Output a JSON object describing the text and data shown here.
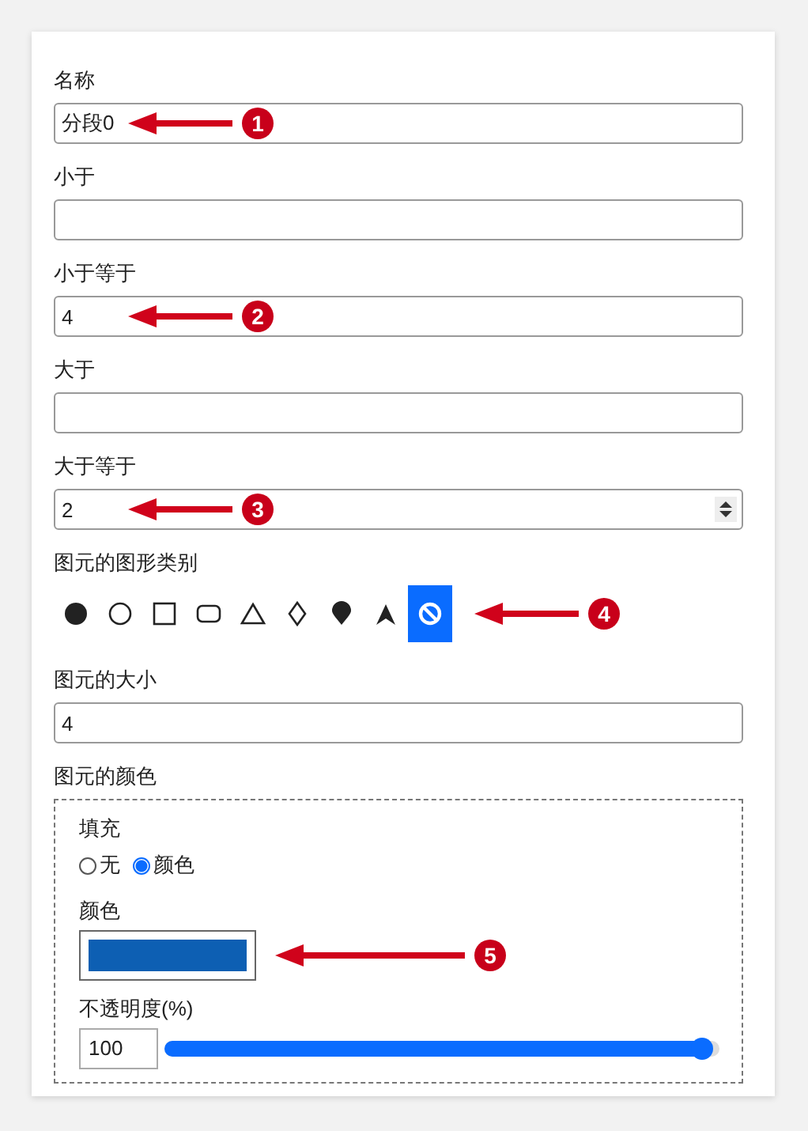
{
  "fields": [
    {
      "label": "名称",
      "value": "分段0",
      "kind": "text",
      "callout": "1"
    },
    {
      "label": "小于",
      "kind": "text"
    },
    {
      "label": "小于等于",
      "value": "4",
      "kind": "text",
      "callout": "2"
    },
    {
      "label": "大于",
      "kind": "text"
    },
    {
      "label": "大于等于",
      "value": "2",
      "kind": "number",
      "callout": "3"
    }
  ],
  "shape_type": {
    "label": "图元的图形类别",
    "callout": "4",
    "shapes": [
      {
        "kind": "filled-circle",
        "selected": false
      },
      {
        "kind": "circle",
        "selected": false
      },
      {
        "kind": "square",
        "selected": false
      },
      {
        "kind": "rounded-rect",
        "selected": false
      },
      {
        "kind": "triangle",
        "selected": false
      },
      {
        "kind": "diamond",
        "selected": false
      },
      {
        "kind": "pin",
        "selected": false
      },
      {
        "kind": "arrow",
        "selected": false
      },
      {
        "kind": "ban",
        "selected": true
      }
    ]
  },
  "size": {
    "label": "图元的大小",
    "value": "4"
  },
  "color_group": {
    "label": "图元的颜色",
    "fill_label": "填充",
    "fill_options": [
      {
        "label": "无",
        "selected": false
      },
      {
        "label": "颜色",
        "selected": true
      }
    ],
    "color_label": "颜色",
    "color": "#0d5fb3",
    "callout": "5",
    "opacity_label": "不透明度(%)",
    "opacity_value": "100",
    "level": 0.97
  }
}
